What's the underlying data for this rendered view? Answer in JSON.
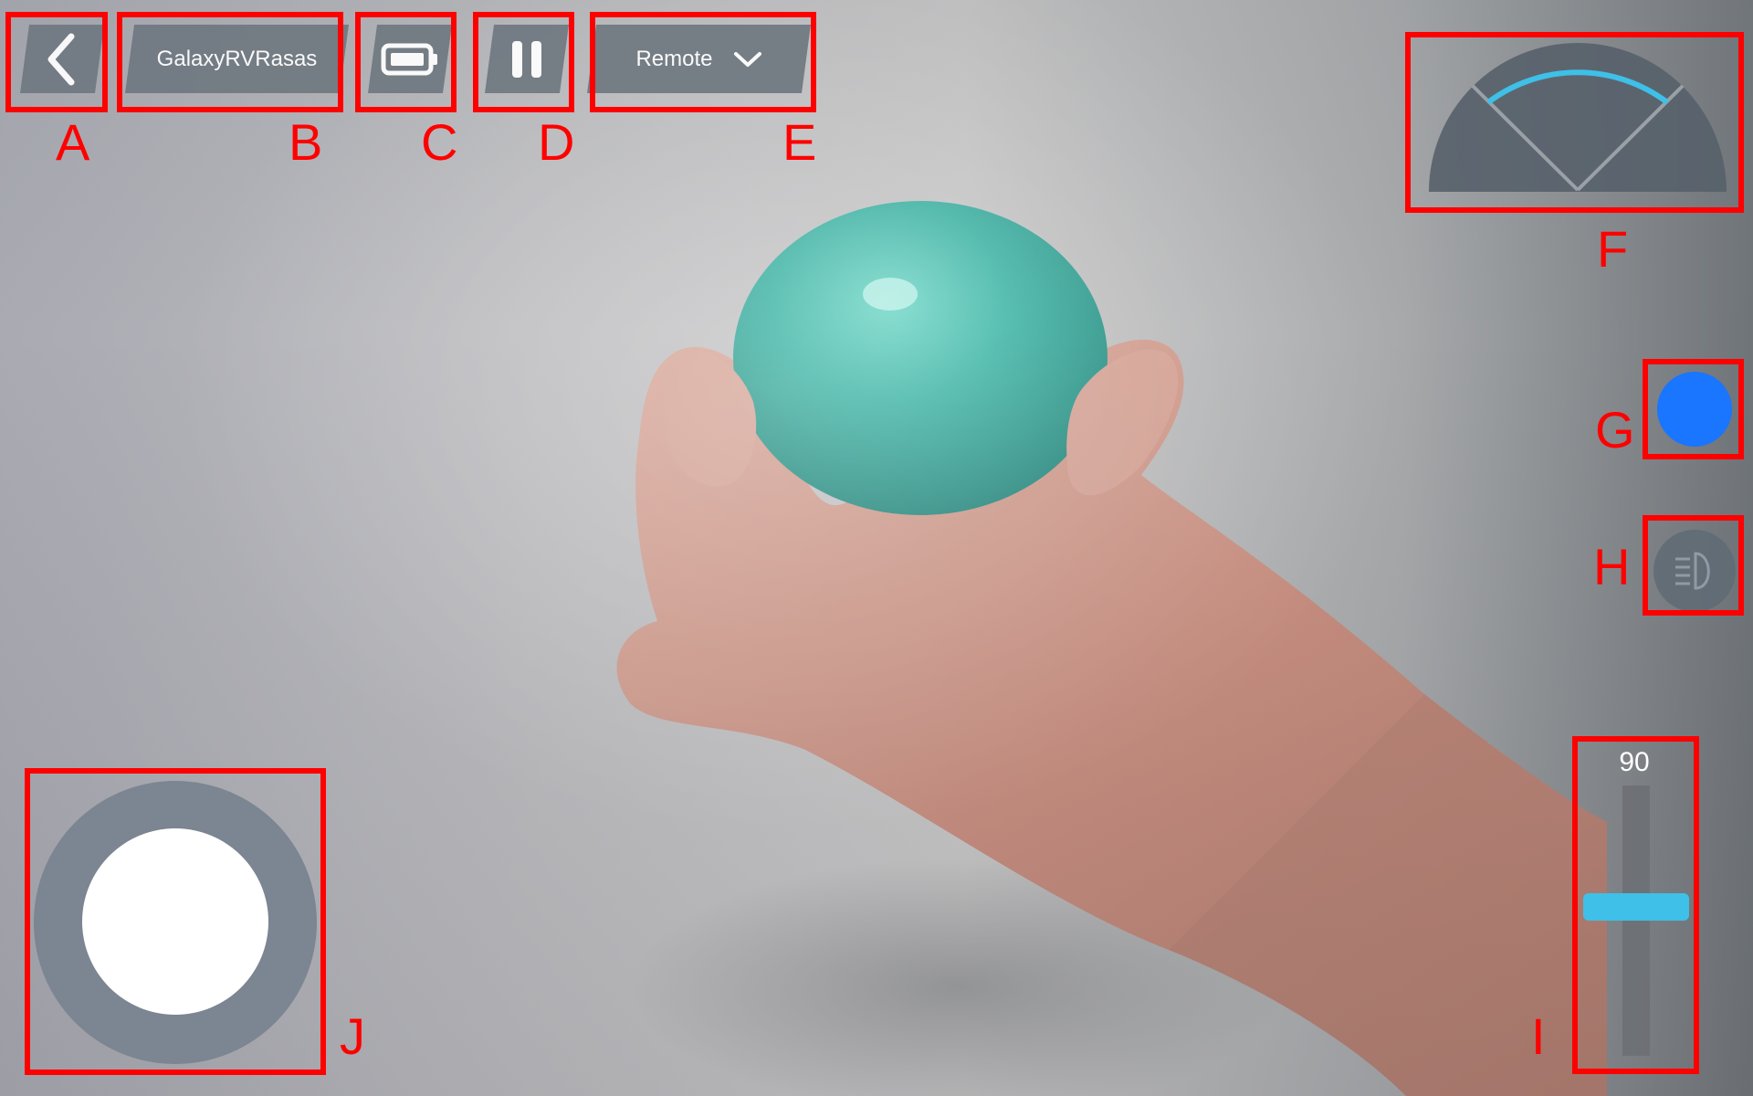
{
  "topbar": {
    "robot_name": "GalaxyRVRasas",
    "mode": "Remote"
  },
  "icons": {
    "back": "chevron-left-icon",
    "battery": "battery-icon",
    "pause": "pause-icon",
    "mode_dropdown": "chevron-down-icon",
    "light": "headlight-icon"
  },
  "speed_slider": {
    "value": "90",
    "level": 0.55
  },
  "colors": {
    "accent": "#3ec0e8",
    "record_button": "#1a75ff",
    "annotation": "#ff0000"
  },
  "annotations": {
    "a": "A",
    "b": "B",
    "c": "C",
    "d": "D",
    "e": "E",
    "f": "F",
    "g": "G",
    "h": "H",
    "i": "I",
    "j": "J"
  }
}
